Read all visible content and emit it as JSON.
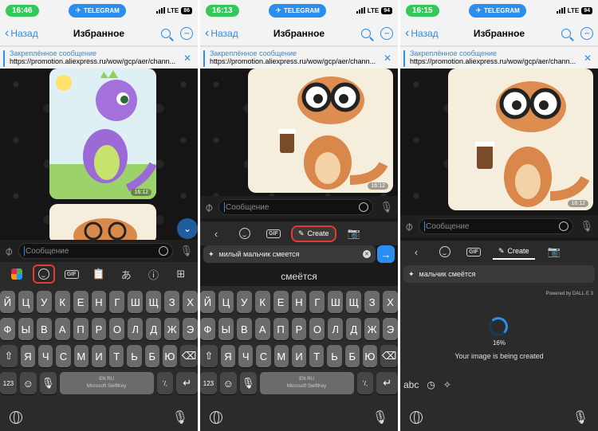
{
  "status_bar": {
    "telegram_label": "TELEGRAM",
    "network": "LTE",
    "times": [
      "16:46",
      "16:13",
      "16:15"
    ],
    "batteries": [
      "86",
      "94",
      "94"
    ]
  },
  "nav": {
    "back_label": "Назад",
    "title": "Избранное"
  },
  "pinned": {
    "title": "Закреплённое сообщение",
    "url": "https://promotion.aliexpress.ru/wow/gcp/aer/chann..."
  },
  "message_timestamp": "16:12",
  "input_placeholder": "Сообщение",
  "keyboard": {
    "row1": [
      "Й",
      "Ц",
      "У",
      "К",
      "Е",
      "Н",
      "Г",
      "Ш",
      "Щ",
      "З",
      "Х"
    ],
    "row2": [
      "Ф",
      "Ы",
      "В",
      "А",
      "П",
      "Р",
      "О",
      "Л",
      "Д",
      "Ж",
      "Э"
    ],
    "row3": [
      "Я",
      "Ч",
      "С",
      "М",
      "И",
      "Т",
      "Ь",
      "Б",
      "Ю"
    ],
    "numbers_key": "123",
    "space_line1": "EN RU",
    "space_line2": "Microsoft SwiftKey",
    "lang_key": "ʼ/,"
  },
  "dalle": {
    "create_label": "Create",
    "prompt_text": "милый мальчик смеется",
    "suggestion": "смеётся",
    "prompt_result": "мальчик смеётся",
    "powered_by": "Powered by DALL·E 3",
    "progress_text": "16%",
    "creating_text": "Your image is being created",
    "abc_label": "abc"
  },
  "colors": {
    "accent": "#2a8df0",
    "highlight": "#e53935",
    "status_green": "#34c759"
  },
  "icons": [
    "back-chevron-icon",
    "search-icon",
    "more-icon",
    "close-icon",
    "attach-icon",
    "sticker-icon",
    "mic-icon",
    "emoji-icon",
    "gif-icon",
    "clipboard-icon",
    "translate-icon",
    "info-icon",
    "grid-icon",
    "camera-icon",
    "sparkle-icon",
    "send-icon",
    "globe-icon",
    "enter-icon",
    "backspace-icon",
    "shift-icon"
  ]
}
